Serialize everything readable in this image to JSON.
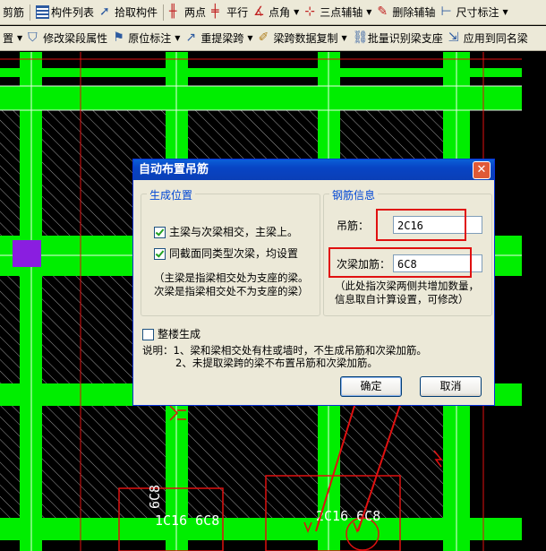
{
  "toolbar1": {
    "items": [
      "剪筋",
      "构件列表",
      "拾取构件",
      "两点",
      "平行",
      "点角",
      "三点辅轴",
      "删除辅轴",
      "尺寸标注"
    ]
  },
  "toolbar2": {
    "items": [
      "置",
      "修改梁段属性",
      "原位标注",
      "重提梁跨",
      "梁跨数据复制",
      "批量识别梁支座",
      "应用到同名梁"
    ]
  },
  "canvas": {
    "texts": [
      "1C16 6C8",
      "2C16 6C8",
      "6C8"
    ]
  },
  "dialog": {
    "title": "自动布置吊筋",
    "group_position": {
      "legend": "生成位置",
      "option1": "主梁与次梁相交，主梁上。",
      "option2": "同截面同类型次梁，均设置",
      "note_line1": "（主梁是指梁相交处为支座的梁。",
      "note_line2": "次梁是指梁相交处不为支座的梁）"
    },
    "group_rebar": {
      "legend": "钢筋信息",
      "hanger_label": "吊筋：",
      "hanger_value": "2C16",
      "secondary_label": "次梁加筋：",
      "secondary_value": "6C8",
      "note_line1": "（此处指次梁两侧共增加数量，",
      "note_line2": "信息取自计算设置，可修改）"
    },
    "whole_building": "整楼生成",
    "explain_line1": "说明：1、梁和梁相交处有柱或墙时，不生成吊筋和次梁加筋。",
    "explain_line2": "2、未提取梁跨的梁不布置吊筋和次梁加筋。",
    "ok": "确定",
    "cancel": "取消",
    "checked1": true,
    "checked2": true,
    "checked_whole": false
  },
  "colors": {
    "beam": "#00ee00",
    "highlight": "#e01010",
    "titlebar": "#0a4fc8"
  }
}
